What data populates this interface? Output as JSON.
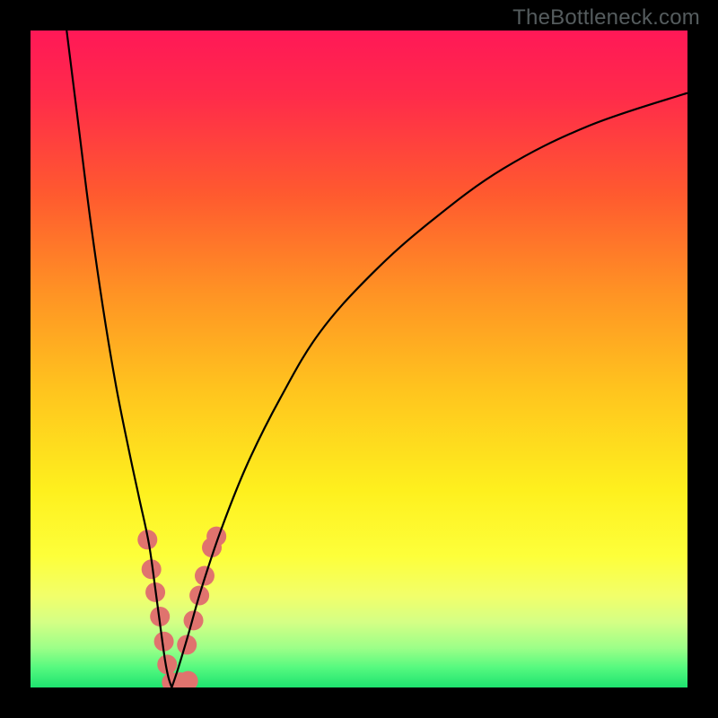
{
  "watermark": "TheBottleneck.com",
  "chart_data": {
    "type": "line",
    "title": "",
    "xlabel": "",
    "ylabel": "",
    "ylim": [
      0,
      100
    ],
    "xlim": [
      0,
      100
    ],
    "legend": false,
    "grid": false,
    "background": {
      "type": "vertical-gradient",
      "stops": [
        {
          "pos": 0.0,
          "color": "#ff1857"
        },
        {
          "pos": 0.1,
          "color": "#ff2b4a"
        },
        {
          "pos": 0.25,
          "color": "#ff5a2f"
        },
        {
          "pos": 0.4,
          "color": "#ff9324"
        },
        {
          "pos": 0.55,
          "color": "#ffc51e"
        },
        {
          "pos": 0.7,
          "color": "#fef01e"
        },
        {
          "pos": 0.8,
          "color": "#fdff3a"
        },
        {
          "pos": 0.86,
          "color": "#f2ff6a"
        },
        {
          "pos": 0.9,
          "color": "#d5ff85"
        },
        {
          "pos": 0.94,
          "color": "#9cff88"
        },
        {
          "pos": 0.97,
          "color": "#55f97f"
        },
        {
          "pos": 1.0,
          "color": "#1ee36f"
        }
      ]
    },
    "series": [
      {
        "name": "left-branch",
        "color": "#000000",
        "x": [
          5.5,
          7,
          9,
          11,
          13,
          15,
          16.5,
          18,
          19,
          19.8,
          20.5,
          21,
          21.5
        ],
        "y": [
          100,
          88,
          72,
          58,
          46,
          36,
          29,
          22,
          15,
          9,
          4,
          1.5,
          0
        ]
      },
      {
        "name": "right-branch",
        "color": "#000000",
        "x": [
          21.5,
          22.5,
          24,
          26,
          29,
          33,
          38,
          44,
          52,
          61,
          72,
          85,
          100
        ],
        "y": [
          0,
          3,
          8,
          15,
          24,
          34,
          44,
          54,
          63,
          71,
          79,
          85.5,
          90.5
        ]
      }
    ],
    "marker_cluster": {
      "color": "#e0736e",
      "r": 11,
      "points": [
        {
          "x": 17.8,
          "y": 22.5
        },
        {
          "x": 18.4,
          "y": 18.0
        },
        {
          "x": 19.0,
          "y": 14.5
        },
        {
          "x": 19.7,
          "y": 10.8
        },
        {
          "x": 20.3,
          "y": 7.0
        },
        {
          "x": 20.8,
          "y": 3.5
        },
        {
          "x": 21.5,
          "y": 0.8
        },
        {
          "x": 22.8,
          "y": 0.8
        },
        {
          "x": 24.0,
          "y": 1.0
        },
        {
          "x": 23.8,
          "y": 6.5
        },
        {
          "x": 24.8,
          "y": 10.2
        },
        {
          "x": 25.7,
          "y": 14.0
        },
        {
          "x": 26.5,
          "y": 17.0
        },
        {
          "x": 27.6,
          "y": 21.3
        },
        {
          "x": 28.3,
          "y": 23.0
        }
      ]
    }
  }
}
